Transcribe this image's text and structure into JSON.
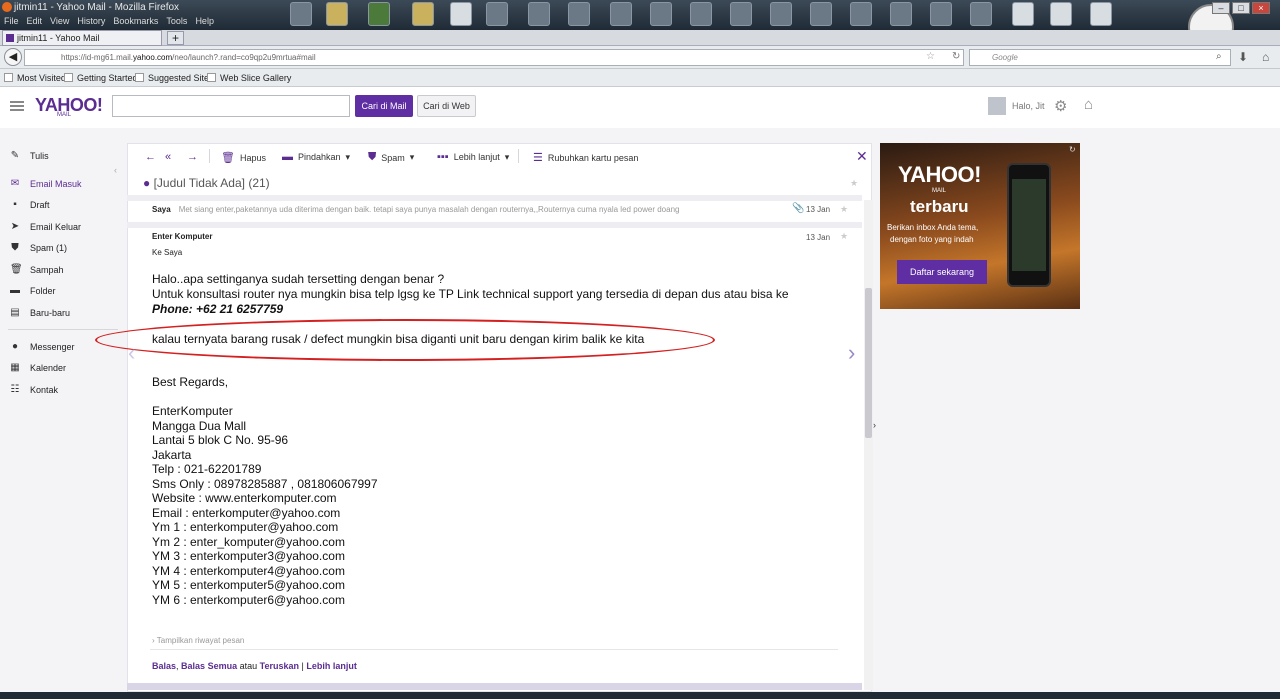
{
  "browser": {
    "window_title": "jitmin11 - Yahoo Mail - Mozilla Firefox",
    "menu": [
      "File",
      "Edit",
      "View",
      "History",
      "Bookmarks",
      "Tools",
      "Help"
    ],
    "tab_title": "jitmin11 - Yahoo Mail",
    "new_tab": "+",
    "url_prefix": "https://id-mg61.mail.",
    "url_domain": "yahoo.com",
    "url_suffix": "/neo/launch?.rand=co9qp2u9mrtua#mail",
    "search_placeholder": "Google",
    "bookmarks": [
      "Most Visited",
      "Getting Started",
      "Suggested Sites",
      "Web Slice Gallery"
    ]
  },
  "header": {
    "logo": "YAHOO!",
    "logo_sub": "MAIL",
    "btn_search_mail": "Cari di Mail",
    "btn_search_web": "Cari di Web",
    "greeting": "Halo, Jit"
  },
  "sidebar": {
    "items": [
      {
        "label": "Tulis",
        "icon": "compose-icon"
      },
      {
        "label": "Email Masuk",
        "icon": "inbox-icon"
      },
      {
        "label": "Draft",
        "icon": "draft-icon"
      },
      {
        "label": "Email Keluar",
        "icon": "sent-icon"
      },
      {
        "label": "Spam (1)",
        "icon": "spam-icon"
      },
      {
        "label": "Sampah",
        "icon": "trash-icon"
      },
      {
        "label": "Folder",
        "icon": "folder-icon"
      },
      {
        "label": "Baru-baru",
        "icon": "recent-icon"
      },
      {
        "label": "Messenger",
        "icon": "messenger-icon"
      },
      {
        "label": "Kalender",
        "icon": "calendar-icon"
      },
      {
        "label": "Kontak",
        "icon": "contacts-icon"
      }
    ]
  },
  "toolbar": {
    "delete": "Hapus",
    "move": "Pindahkan",
    "spam": "Spam",
    "more": "Lebih lanjut",
    "summarize": "Rubuhkan kartu pesan"
  },
  "conversation": {
    "subject": "[Judul Tidak Ada] (21)",
    "prev_message": {
      "sender": "Saya",
      "snippet": "Met siang enter,paketannya uda diterima dengan baik. tetapi saya punya masalah dengan routernya,,Routernya cuma nyala led power doang",
      "date": "13 Jan"
    },
    "message": {
      "sender": "Enter Komputer",
      "recipient": "Ke  Saya",
      "date": "13 Jan",
      "lines": [
        "Halo..apa settinganya sudah tersetting dengan benar ?",
        "Untuk konsultasi router nya mungkin bisa telp lgsg ke TP Link technical support yang tersedia di depan dus atau bisa ke"
      ],
      "phone_label": "Phone:",
      "phone_value": " +62 21 6257759",
      "highlight": "kalau ternyata barang rusak / defect mungkin bisa diganti unit baru dengan kirim balik ke kita",
      "regards": "Best Regards,",
      "signature": [
        "EnterKomputer",
        "Mangga Dua Mall",
        "Lantai 5 blok C No. 95-96",
        "Jakarta",
        "Telp : 021-62201789",
        "Sms Only : 08978285887 , 081806067997",
        "Website : www.enterkomputer.com",
        "Email : enterkomputer@yahoo.com",
        "Ym 1 : enterkomputer@yahoo.com",
        "Ym 2 : enter_komputer@yahoo.com",
        "YM 3 : enterkomputer3@yahoo.com",
        "YM 4 : enterkomputer4@yahoo.com",
        "YM 5 : enterkomputer5@yahoo.com",
        "YM 6 : enterkomputer6@yahoo.com"
      ],
      "show_history": "Tampilkan riwayat pesan"
    },
    "reply": {
      "reply": "Balas",
      "reply_all": "Balas Semua",
      "or": "atau",
      "forward": "Teruskan",
      "sep": "|",
      "more": "Lebih lanjut"
    }
  },
  "ad": {
    "logo": "YAHOO!",
    "logo_sub": "MAIL",
    "headline": "terbaru",
    "line1": "Berikan inbox Anda tema,",
    "line2": "dengan foto yang indah",
    "button": "Daftar sekarang"
  },
  "colors": {
    "brand": "#5b2d91",
    "highlight_oval": "#d42020"
  }
}
